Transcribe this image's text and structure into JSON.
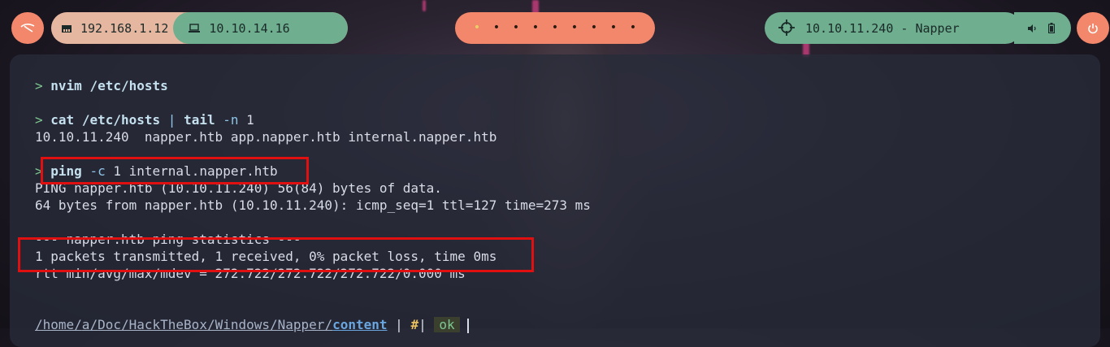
{
  "topbar": {
    "local_ip": "192.168.1.12",
    "vpn_ip": "10.10.14.16",
    "workspaces": [
      "•",
      "•",
      "•",
      "•",
      "•",
      "•",
      "•",
      "•",
      "•"
    ],
    "target": "10.10.11.240 - Napper",
    "icons": {
      "menu": "kali-dragon-icon",
      "local": "ethernet-icon",
      "vpn": "laptop-icon",
      "target": "crosshair-icon",
      "volume": "volume-icon",
      "battery": "battery-icon",
      "power": "power-icon"
    },
    "colors": {
      "orange": "#f2876b",
      "green": "#6fae8f",
      "peach": "#e6b7a0"
    }
  },
  "terminal": {
    "prompt_symbol": ">",
    "lines": {
      "cmd1": {
        "cmd": "nvim",
        "arg": "/etc/hosts"
      },
      "cmd2": {
        "cmd": "cat",
        "arg": "/etc/hosts",
        "pipe": "|",
        "cmd2": "tail",
        "flag": "-n",
        "arg2": "1"
      },
      "out2": "10.10.11.240  napper.htb app.napper.htb internal.napper.htb",
      "cmd3": {
        "cmd": "ping",
        "flag": "-c",
        "arg": "1 internal.napper.htb"
      },
      "out3a": "PING napper.htb (10.10.11.240) 56(84) bytes of data.",
      "out3b": "64 bytes from napper.htb (10.10.11.240): icmp_seq=1 ttl=127 time=273 ms",
      "out3c": "--- napper.htb ping statistics ---",
      "out3d": "1 packets transmitted, 1 received, 0% packet loss, time 0ms",
      "out3e": "rtt min/avg/max/mdev = 272.722/272.722/272.722/0.000 ms"
    },
    "status": {
      "path_prefix": "/home/",
      "path_a": "a",
      "path_sep": "/",
      "path_doc": "Doc",
      "path_rest": "/HackTheBox/Windows/Napper/",
      "path_cwd": "content",
      "sep": "|",
      "branch": "#",
      "ok": "ok"
    }
  }
}
